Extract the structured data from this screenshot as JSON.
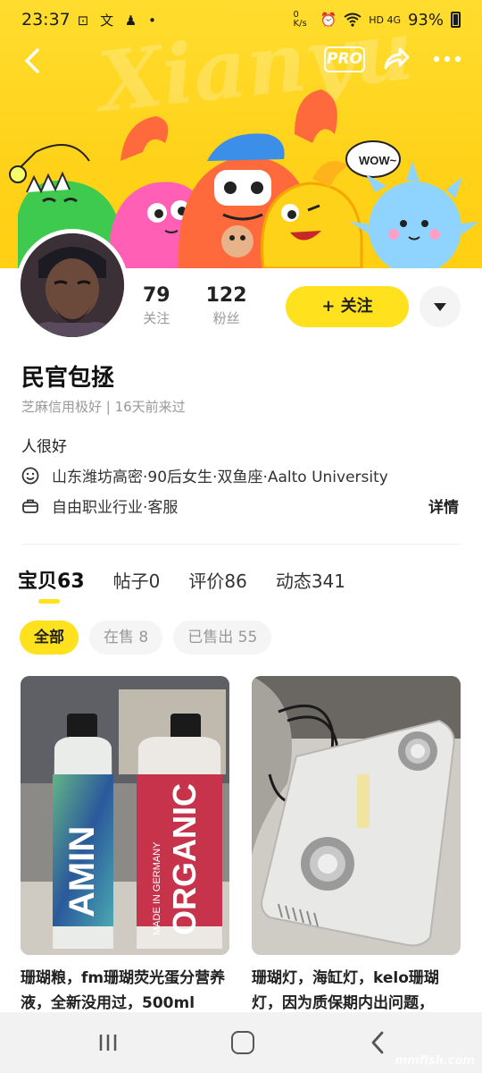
{
  "status_bar": {
    "time": "23:37",
    "left_icons": "⊡ 文 ♟ •",
    "network_speed": "0 K/s",
    "signal": "HD 4G",
    "battery": "93%"
  },
  "header": {
    "pro_label": "PRO",
    "watermark": "Xianyu"
  },
  "profile": {
    "following_count": "79",
    "following_label": "关注",
    "followers_count": "122",
    "followers_label": "粉丝",
    "follow_button": "+ 关注",
    "name": "民官包拯",
    "credit_text": "芝麻信用极好 | 16天前来过",
    "bio": "人很好",
    "location_info": "山东潍坊高密·90后女生·双鱼座·Aalto University",
    "job_info": "自由职业行业·客服",
    "details_link": "详情"
  },
  "tabs": [
    {
      "label": "宝贝",
      "count": "63"
    },
    {
      "label": "帖子",
      "count": "0"
    },
    {
      "label": "评价",
      "count": "86"
    },
    {
      "label": "动态",
      "count": "341"
    }
  ],
  "filters": [
    {
      "label": "全部"
    },
    {
      "label": "在售 8"
    },
    {
      "label": "已售出 55"
    }
  ],
  "products": [
    {
      "title": "珊瑚粮，fm珊瑚荧光蛋分营养液，全新没用过，500ml",
      "bottle1_text": "AMIN",
      "bottle2_text": "ORGANIC",
      "bottle2_sub": "MADE IN GERMANY"
    },
    {
      "title": "珊瑚灯，海缸灯，kelo珊瑚灯，因为质保期内出问题，"
    }
  ],
  "corner_watermark": "mmfish.com"
}
